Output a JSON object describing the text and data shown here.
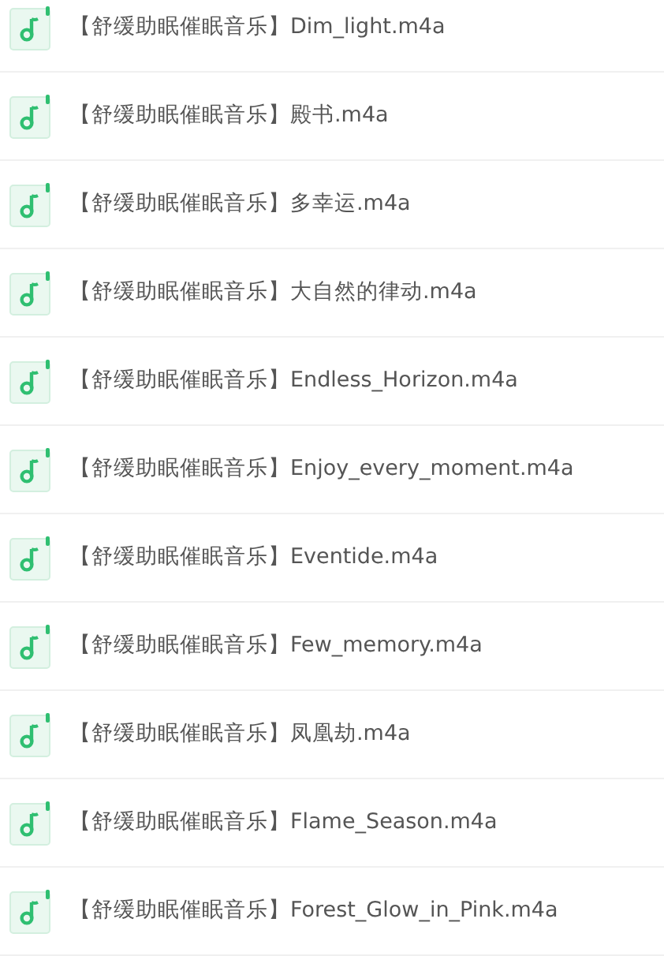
{
  "files": [
    {
      "name": "【舒缓助眠催眠音乐】Dim_light.m4a"
    },
    {
      "name": "【舒缓助眠催眠音乐】殿书.m4a"
    },
    {
      "name": "【舒缓助眠催眠音乐】多幸运.m4a"
    },
    {
      "name": "【舒缓助眠催眠音乐】大自然的律动.m4a"
    },
    {
      "name": "【舒缓助眠催眠音乐】Endless_Horizon.m4a"
    },
    {
      "name": "【舒缓助眠催眠音乐】Enjoy_every_moment.m4a"
    },
    {
      "name": "【舒缓助眠催眠音乐】Eventide.m4a"
    },
    {
      "name": "【舒缓助眠催眠音乐】Few_memory.m4a"
    },
    {
      "name": "【舒缓助眠催眠音乐】凤凰劫.m4a"
    },
    {
      "name": "【舒缓助眠催眠音乐】Flame_Season.m4a"
    },
    {
      "name": "【舒缓助眠催眠音乐】Forest_Glow_in_Pink.m4a"
    }
  ]
}
